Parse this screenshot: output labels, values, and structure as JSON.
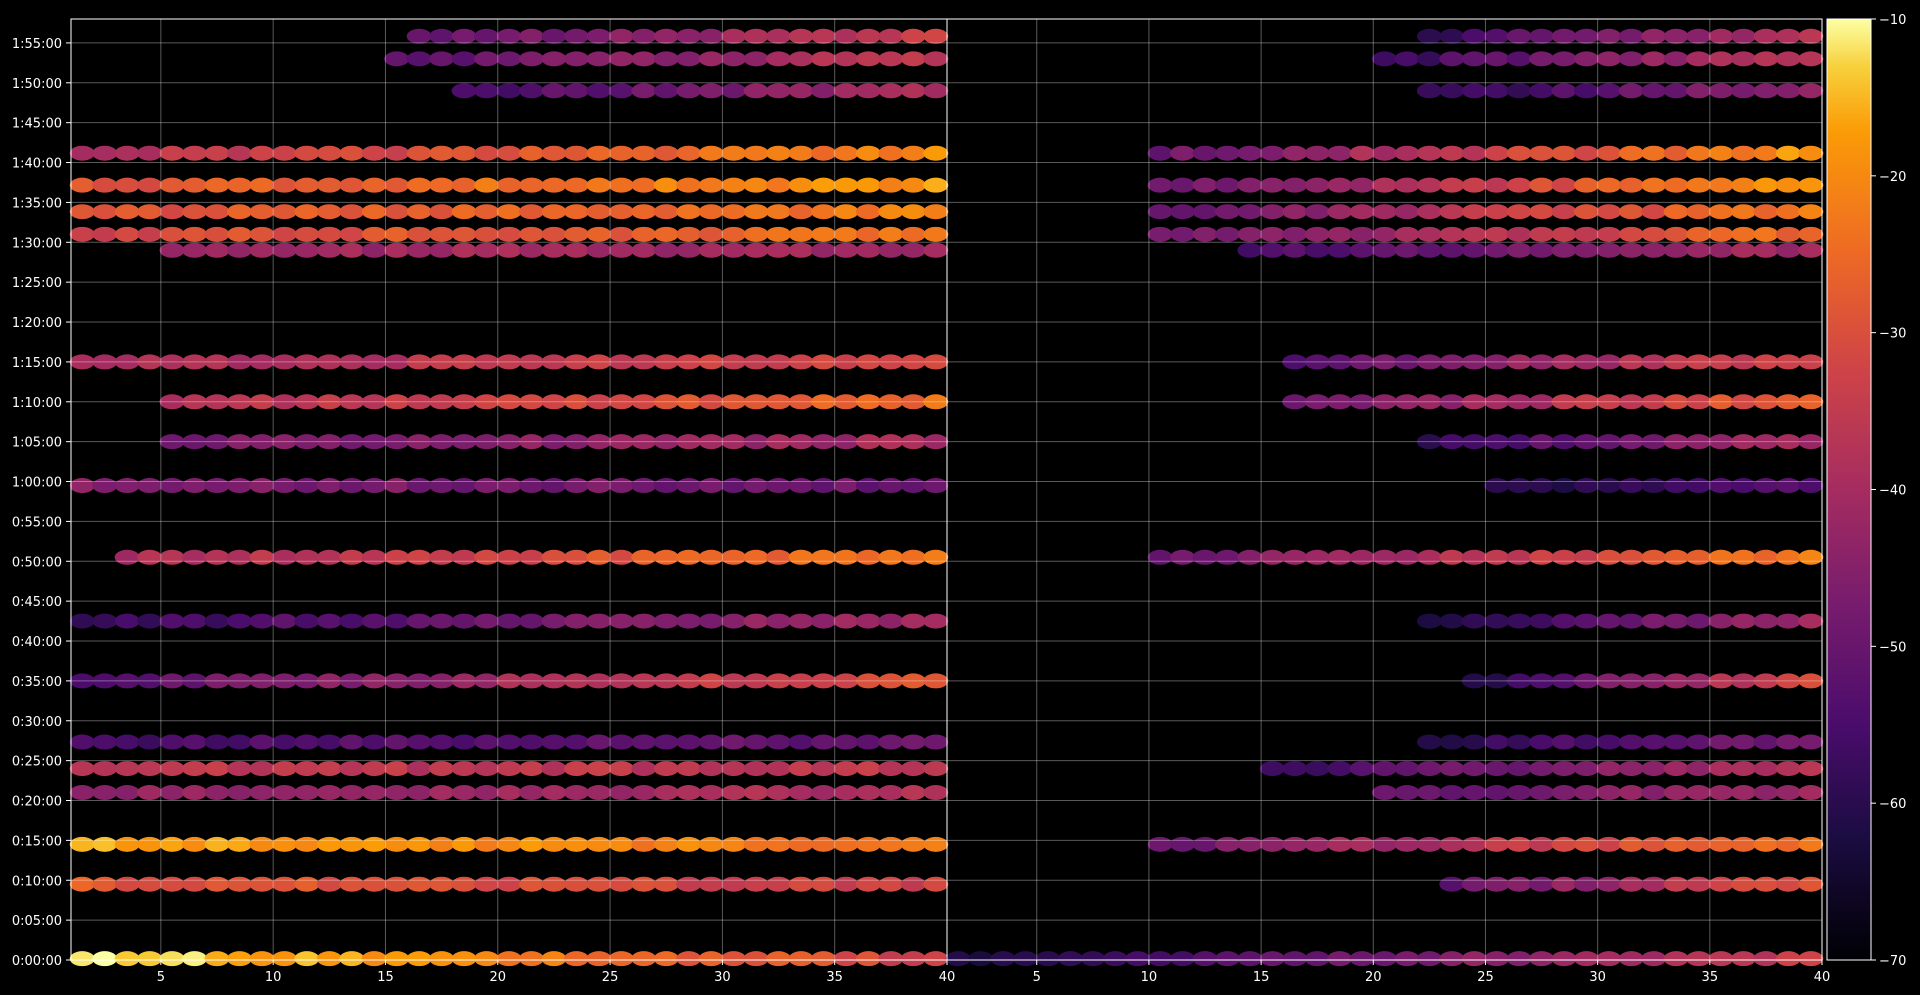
{
  "chart_data": {
    "type": "heatmap",
    "title": "",
    "xlabel": "",
    "ylabel": "",
    "background": "#000000",
    "grid": true,
    "colormap": "inferno",
    "panels": [
      {
        "name": "",
        "xlim": [
          1,
          40
        ],
        "x_ticks": [
          5,
          10,
          15,
          20,
          25,
          30,
          35,
          40
        ],
        "x_tick_labels": [
          "5",
          "10",
          "15",
          "20",
          "25",
          "30",
          "35",
          "40"
        ]
      },
      {
        "name": "",
        "xlim": [
          1,
          40
        ],
        "x_ticks": [
          5,
          10,
          15,
          20,
          25,
          30,
          35,
          40
        ],
        "x_tick_labels": [
          "5",
          "10",
          "15",
          "20",
          "25",
          "30",
          "35",
          "40"
        ]
      }
    ],
    "y_axis": {
      "unit": "time",
      "lim_seconds": [
        0,
        7080
      ],
      "ticks": [
        "0:00:00",
        "0:05:00",
        "0:10:00",
        "0:15:00",
        "0:20:00",
        "0:25:00",
        "0:30:00",
        "0:35:00",
        "0:40:00",
        "0:45:00",
        "0:50:00",
        "0:55:00",
        "1:00:00",
        "1:05:00",
        "1:10:00",
        "1:15:00",
        "1:20:00",
        "1:25:00",
        "1:30:00",
        "1:35:00",
        "1:40:00",
        "1:45:00",
        "1:50:00",
        "1:55:00"
      ]
    },
    "colorbar": {
      "range": [
        -70,
        -10
      ],
      "ticks": [
        -10,
        -20,
        -30,
        -40,
        -50,
        -60,
        -70
      ],
      "tick_labels": [
        "−10",
        "−20",
        "−30",
        "−40",
        "−50",
        "−60",
        "−70"
      ]
    },
    "bands": [
      {
        "time_seconds": 10,
        "left_start": 1,
        "left_peak": -11,
        "left_end": -33,
        "right_start": 1,
        "right_peak": -63,
        "right_end": -34
      },
      {
        "time_seconds": 570,
        "left_start": 1,
        "left_peak": -28,
        "left_end": -34,
        "right_start": 23,
        "right_peak": -52,
        "right_end": -28
      },
      {
        "time_seconds": 870,
        "left_start": 1,
        "left_peak": -16,
        "left_end": -24,
        "right_start": 10,
        "right_peak": -50,
        "right_end": -23
      },
      {
        "time_seconds": 1260,
        "left_start": 1,
        "left_peak": -44,
        "left_end": -38,
        "right_start": 20,
        "right_peak": -52,
        "right_end": -40
      },
      {
        "time_seconds": 1440,
        "left_start": 1,
        "left_peak": -36,
        "left_end": -36,
        "right_start": 15,
        "right_peak": -56,
        "right_end": -38
      },
      {
        "time_seconds": 1640,
        "left_start": 1,
        "left_peak": -55,
        "left_end": -50,
        "right_start": 22,
        "right_peak": -60,
        "right_end": -48
      },
      {
        "time_seconds": 2100,
        "left_start": 1,
        "left_peak": -53,
        "left_end": -28,
        "right_start": 24,
        "right_peak": -60,
        "right_end": -30
      },
      {
        "time_seconds": 2550,
        "left_start": 1,
        "left_peak": -58,
        "left_end": -40,
        "right_start": 22,
        "right_peak": -60,
        "right_end": -42
      },
      {
        "time_seconds": 3030,
        "left_start": 3,
        "left_peak": -40,
        "left_end": -22,
        "right_start": 10,
        "right_peak": -50,
        "right_end": -22
      },
      {
        "time_seconds": 3570,
        "left_start": 1,
        "left_peak": -46,
        "left_end": -50,
        "right_start": 25,
        "right_peak": -62,
        "right_end": -52
      },
      {
        "time_seconds": 3900,
        "left_start": 5,
        "left_peak": -48,
        "left_end": -40,
        "right_start": 22,
        "right_peak": -58,
        "right_end": -40
      },
      {
        "time_seconds": 4200,
        "left_start": 5,
        "left_peak": -38,
        "left_end": -25,
        "right_start": 16,
        "right_peak": -50,
        "right_end": -26
      },
      {
        "time_seconds": 4500,
        "left_start": 1,
        "left_peak": -40,
        "left_end": -32,
        "right_start": 16,
        "right_peak": -52,
        "right_end": -32
      },
      {
        "time_seconds": 5340,
        "left_start": 5,
        "left_peak": -42,
        "left_end": -40,
        "right_start": 14,
        "right_peak": -56,
        "right_end": -40
      },
      {
        "time_seconds": 5460,
        "left_start": 1,
        "left_peak": -32,
        "left_end": -24,
        "right_start": 10,
        "right_peak": -50,
        "right_end": -24
      },
      {
        "time_seconds": 5630,
        "left_start": 1,
        "left_peak": -30,
        "left_end": -22,
        "right_start": 10,
        "right_peak": -50,
        "right_end": -22
      },
      {
        "time_seconds": 5830,
        "left_start": 1,
        "left_peak": -30,
        "left_end": -18,
        "right_start": 10,
        "right_peak": -50,
        "right_end": -18
      },
      {
        "time_seconds": 6070,
        "left_start": 1,
        "left_peak": -38,
        "left_end": -20,
        "right_start": 10,
        "right_peak": -50,
        "right_end": -18
      },
      {
        "time_seconds": 6540,
        "left_start": 18,
        "left_peak": -56,
        "left_end": -40,
        "right_start": 22,
        "right_peak": -60,
        "right_end": -42
      },
      {
        "time_seconds": 6780,
        "left_start": 15,
        "left_peak": -52,
        "left_end": -36,
        "right_start": 20,
        "right_peak": -58,
        "right_end": -36
      },
      {
        "time_seconds": 6950,
        "left_start": 16,
        "left_peak": -52,
        "left_end": -34,
        "right_start": 22,
        "right_peak": -58,
        "right_end": -36
      }
    ]
  }
}
